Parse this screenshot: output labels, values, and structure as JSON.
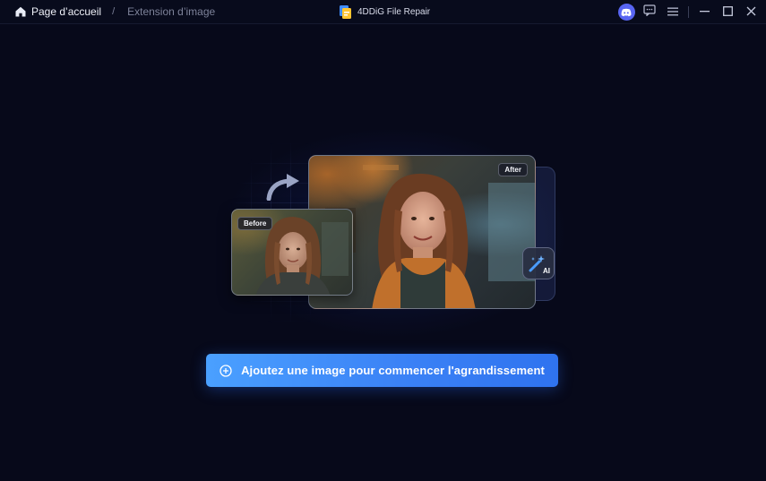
{
  "breadcrumb": {
    "home_label": "Page d’accueil",
    "separator": "/",
    "current_label": "Extension d’image"
  },
  "app": {
    "name": "4DDiG File Repair"
  },
  "window_controls": {
    "icons": [
      "discord-icon",
      "feedback-icon",
      "menu-icon",
      "minimize-icon",
      "maximize-icon",
      "close-icon"
    ]
  },
  "illustration": {
    "after_label": "After",
    "before_label": "Before",
    "ai_badge_text": "AI"
  },
  "cta": {
    "label": "Ajoutez une image pour commencer l'agrandissement",
    "icon": "plus-circle-icon"
  },
  "colors": {
    "background": "#07091a",
    "accent": "#3b82f6",
    "discord": "#5865f2"
  }
}
